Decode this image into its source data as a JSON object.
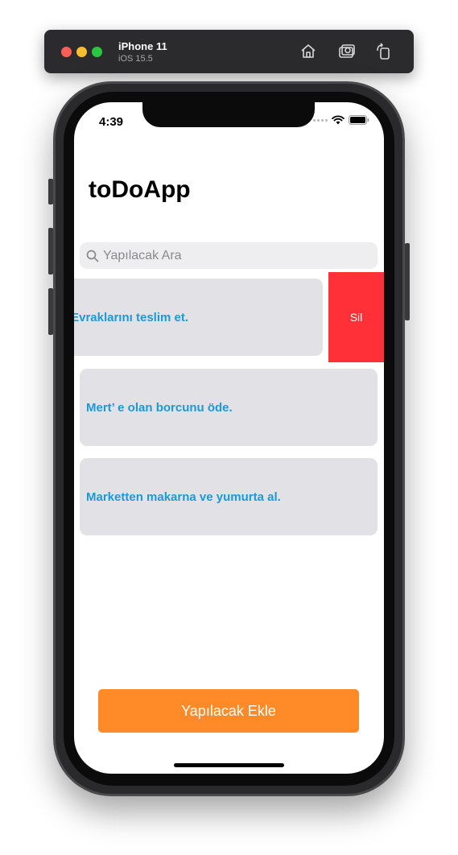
{
  "simulator": {
    "device_name": "iPhone 11",
    "os_version": "iOS 15.5",
    "icons": [
      "home-icon",
      "screenshot-icon",
      "rotate-icon"
    ]
  },
  "status_bar": {
    "time": "4:39",
    "icons": [
      "signal-dots-icon",
      "wifi-icon",
      "battery-icon"
    ]
  },
  "app": {
    "title": "toDoApp"
  },
  "search": {
    "placeholder": "Yapılacak Ara",
    "value": ""
  },
  "todos": [
    {
      "text": "Evraklarını teslim et.",
      "swiped_open": true
    },
    {
      "text": "Mert’ e olan borcunu öde.",
      "swiped_open": false
    },
    {
      "text": "Marketten makarna ve yumurta al.",
      "swiped_open": false
    }
  ],
  "swipe_action": {
    "label": "Sil",
    "color": "#ff3037"
  },
  "add_button": {
    "label": "Yapılacak Ekle",
    "color": "#ff8a27"
  },
  "colors": {
    "accent_text": "#1a9ad6",
    "card_background": "#e2e2e6"
  }
}
